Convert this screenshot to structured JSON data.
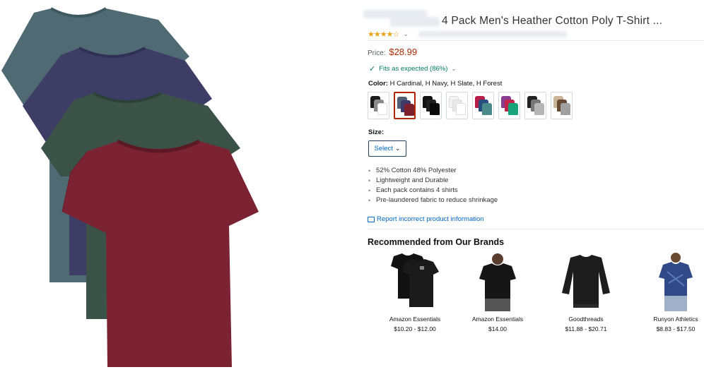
{
  "product": {
    "title": "4 Pack Men's Heather Cotton Poly T-Shirt ...",
    "rating_stars": "★★★★☆",
    "price_label": "Price:",
    "price": "$28.99",
    "fit_text": "Fits as expected (86%)",
    "color_label": "Color:",
    "color_value": "H Cardinal, H Navy, H Slate, H Forest",
    "size_label": "Size:",
    "size_select": "Select",
    "bullets": [
      "52% Cotton 48% Polyester",
      "Lightweight and Durable",
      "Each pack contains 4 shirts",
      "Pre-laundered fabric to reduce shrinkage"
    ],
    "report_link": "Report incorrect product information"
  },
  "swatches": [
    {
      "colors": [
        "#1a1a1a",
        "#8a8a8a",
        "#ffffff"
      ]
    },
    {
      "colors": [
        "#4f5e73",
        "#3e3a6b",
        "#7d1f2c"
      ]
    },
    {
      "colors": [
        "#121212",
        "#1e1e1e",
        "#0a0a0a"
      ]
    },
    {
      "colors": [
        "#f2f2f2",
        "#e8e8e8",
        "#ffffff"
      ]
    },
    {
      "colors": [
        "#b81d4a",
        "#2b4c7e",
        "#4a8a8a"
      ]
    },
    {
      "colors": [
        "#8a3d8f",
        "#c0264b",
        "#18a37a"
      ]
    },
    {
      "colors": [
        "#222222",
        "#777777",
        "#b5b5b5"
      ]
    },
    {
      "colors": [
        "#c9b59a",
        "#6b4a33",
        "#a0a0a0"
      ]
    }
  ],
  "recommended": {
    "title": "Recommended from Our Brands",
    "items": [
      {
        "brand": "Amazon Essentials",
        "price": "$10.20 - $12.00",
        "kind": "tshirt-pair",
        "color": "#111111"
      },
      {
        "brand": "Amazon Essentials",
        "price": "$14.00",
        "kind": "model-tee",
        "color": "#161616"
      },
      {
        "brand": "Goodthreads",
        "price": "$11.88 - $20.71",
        "kind": "sweater",
        "color": "#1d1d1d"
      },
      {
        "brand": "Runyon Athletics",
        "price": "$8.83 - $17.50",
        "kind": "model-athletic",
        "color": "#2f4a86"
      }
    ]
  },
  "colors": {
    "price_red": "#b12704",
    "link_blue": "#0066c0",
    "fit_green": "#067d62",
    "star_gold": "#e8a317"
  }
}
